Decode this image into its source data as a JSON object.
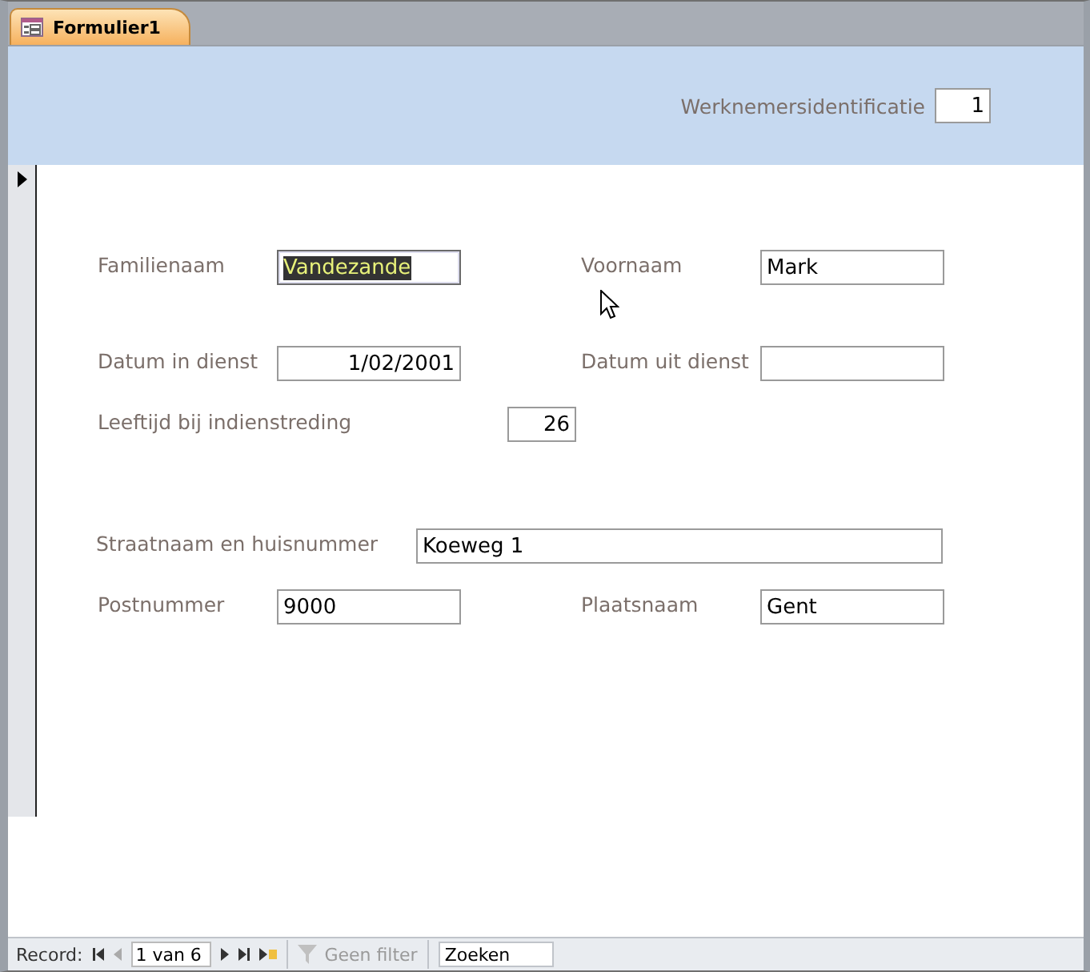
{
  "tabs": [
    {
      "title": "Formulier1",
      "selected": true
    }
  ],
  "header": {
    "label": "Werknemersidentificatie",
    "value": "1"
  },
  "rows": [
    {
      "fields": [
        {
          "label": "Familienaam",
          "value": "Vandezande",
          "kind": "text",
          "selected": true
        },
        {
          "label": "Voornaam",
          "value": "Mark",
          "kind": "text",
          "selected": false
        }
      ]
    },
    {
      "fields": [
        {
          "label": "Datum in dienst",
          "value": "1/02/2001",
          "kind": "date",
          "selected": false
        },
        {
          "label": "Datum uit dienst",
          "kind": "text",
          "selected": false
        }
      ]
    },
    {
      "fields": [
        {
          "label": "Leeftijd bij indienstreding",
          "value": "26",
          "kind": "number",
          "selected": false
        }
      ]
    },
    {
      "fields": [
        {
          "label": "Straatnaam en huisnummer",
          "value": "Koeweg 1",
          "kind": "long",
          "selected": false
        }
      ]
    },
    {
      "fields": [
        {
          "label": "Postnummer",
          "value": "9000",
          "kind": "text",
          "selected": false
        },
        {
          "label": "Plaatsnaam",
          "value": "Gent",
          "kind": "text",
          "selected": false
        }
      ]
    }
  ],
  "navigation": {
    "label": "Record:",
    "position": "1 van 6",
    "first_disabled": false,
    "previous_disabled": true,
    "filter": {
      "label": "Geen filter",
      "disabled": true
    },
    "search": {
      "placeholder": "Zoeken"
    }
  }
}
